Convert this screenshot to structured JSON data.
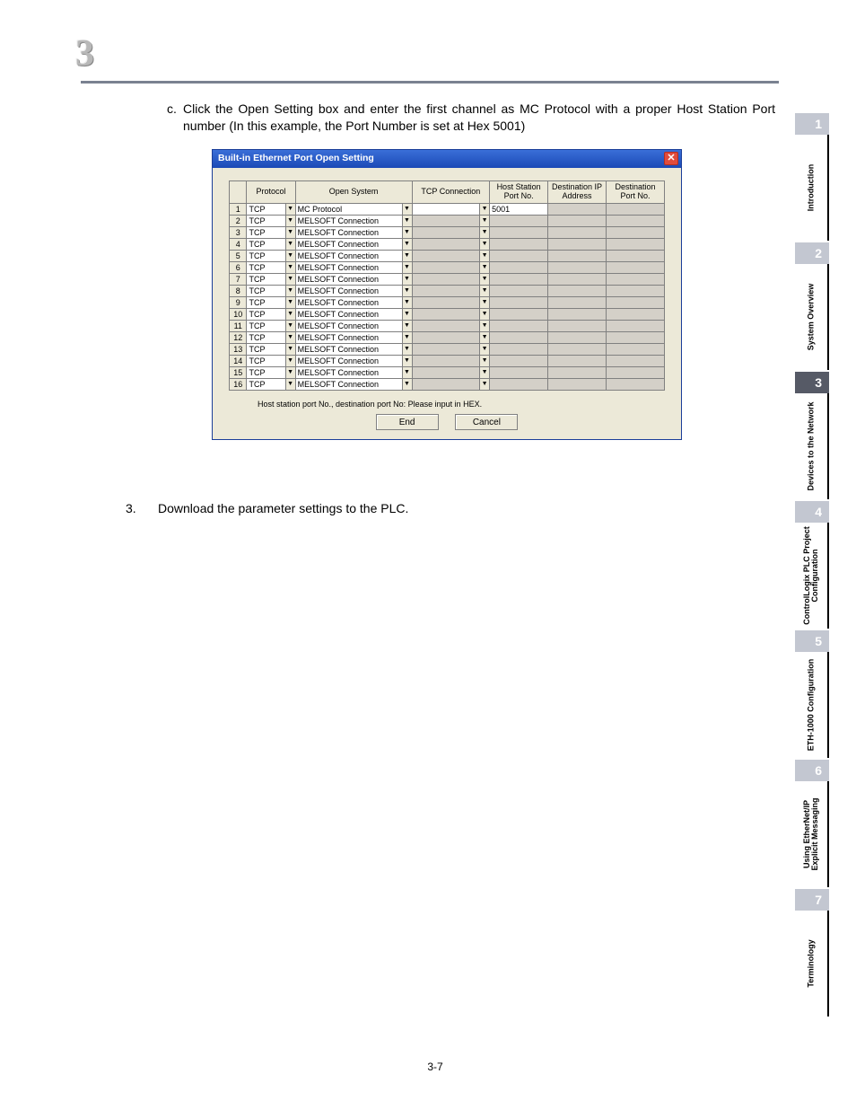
{
  "chapter_icon": "3",
  "step_c": {
    "marker": "c.",
    "text": "Click the Open Setting box and enter the first channel as MC Protocol with a proper Host Station Port number (In this example, the Port Number is set at Hex 5001)"
  },
  "dialog": {
    "title": "Built-in Ethernet Port Open Setting",
    "headers": [
      "",
      "Protocol",
      "Open System",
      "TCP Connection",
      "Host Station Port No.",
      "Destination IP Address",
      "Destination Port No."
    ],
    "rows": [
      {
        "n": "1",
        "protocol": "TCP",
        "open_system": "MC Protocol",
        "tcp": "",
        "host_port": "5001",
        "dest_ip": "",
        "dest_port": ""
      },
      {
        "n": "2",
        "protocol": "TCP",
        "open_system": "MELSOFT Connection",
        "tcp": "",
        "host_port": "",
        "dest_ip": "",
        "dest_port": ""
      },
      {
        "n": "3",
        "protocol": "TCP",
        "open_system": "MELSOFT Connection",
        "tcp": "",
        "host_port": "",
        "dest_ip": "",
        "dest_port": ""
      },
      {
        "n": "4",
        "protocol": "TCP",
        "open_system": "MELSOFT Connection",
        "tcp": "",
        "host_port": "",
        "dest_ip": "",
        "dest_port": ""
      },
      {
        "n": "5",
        "protocol": "TCP",
        "open_system": "MELSOFT Connection",
        "tcp": "",
        "host_port": "",
        "dest_ip": "",
        "dest_port": ""
      },
      {
        "n": "6",
        "protocol": "TCP",
        "open_system": "MELSOFT Connection",
        "tcp": "",
        "host_port": "",
        "dest_ip": "",
        "dest_port": ""
      },
      {
        "n": "7",
        "protocol": "TCP",
        "open_system": "MELSOFT Connection",
        "tcp": "",
        "host_port": "",
        "dest_ip": "",
        "dest_port": ""
      },
      {
        "n": "8",
        "protocol": "TCP",
        "open_system": "MELSOFT Connection",
        "tcp": "",
        "host_port": "",
        "dest_ip": "",
        "dest_port": ""
      },
      {
        "n": "9",
        "protocol": "TCP",
        "open_system": "MELSOFT Connection",
        "tcp": "",
        "host_port": "",
        "dest_ip": "",
        "dest_port": ""
      },
      {
        "n": "10",
        "protocol": "TCP",
        "open_system": "MELSOFT Connection",
        "tcp": "",
        "host_port": "",
        "dest_ip": "",
        "dest_port": ""
      },
      {
        "n": "11",
        "protocol": "TCP",
        "open_system": "MELSOFT Connection",
        "tcp": "",
        "host_port": "",
        "dest_ip": "",
        "dest_port": ""
      },
      {
        "n": "12",
        "protocol": "TCP",
        "open_system": "MELSOFT Connection",
        "tcp": "",
        "host_port": "",
        "dest_ip": "",
        "dest_port": ""
      },
      {
        "n": "13",
        "protocol": "TCP",
        "open_system": "MELSOFT Connection",
        "tcp": "",
        "host_port": "",
        "dest_ip": "",
        "dest_port": ""
      },
      {
        "n": "14",
        "protocol": "TCP",
        "open_system": "MELSOFT Connection",
        "tcp": "",
        "host_port": "",
        "dest_ip": "",
        "dest_port": ""
      },
      {
        "n": "15",
        "protocol": "TCP",
        "open_system": "MELSOFT Connection",
        "tcp": "",
        "host_port": "",
        "dest_ip": "",
        "dest_port": ""
      },
      {
        "n": "16",
        "protocol": "TCP",
        "open_system": "MELSOFT Connection",
        "tcp": "",
        "host_port": "",
        "dest_ip": "",
        "dest_port": ""
      }
    ],
    "hint": "Host station port No., destination port No: Please input in HEX.",
    "end_btn": "End",
    "cancel_btn": "Cancel"
  },
  "step_3": {
    "marker": "3.",
    "text": "Download the parameter settings to the PLC."
  },
  "page_number": "3-7",
  "tabs": [
    {
      "n": "1",
      "label": "Introduction",
      "style": "light"
    },
    {
      "n": "2",
      "label": "System Overview",
      "style": "light"
    },
    {
      "n": "3",
      "label": "Devices to the Network",
      "style": "dark"
    },
    {
      "n": "4",
      "label": "ControlLogix PLC Project Configuration",
      "style": "light"
    },
    {
      "n": "5",
      "label": "ETH-1000 Configuration",
      "style": "light"
    },
    {
      "n": "6",
      "label": "Using EtherNet/IP Explicit Messaging",
      "style": "light"
    },
    {
      "n": "7",
      "label": "Terminology",
      "style": "light"
    }
  ]
}
